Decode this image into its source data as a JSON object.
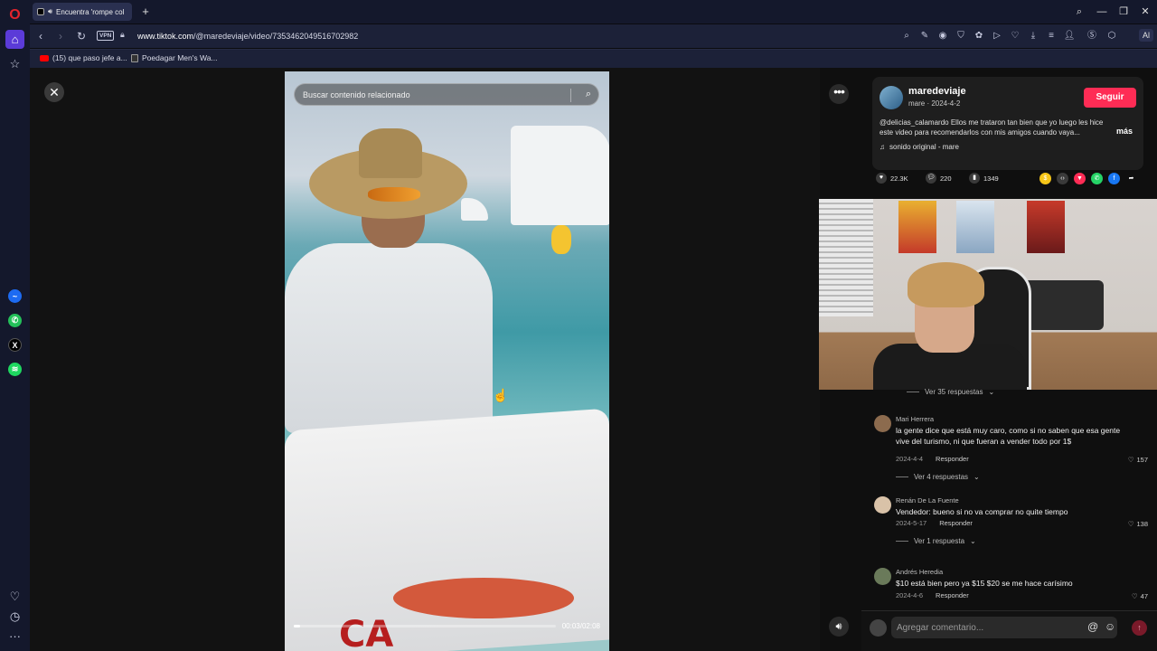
{
  "browser": {
    "tab_title": "Encuentra 'rompe col",
    "url_domain": "www.tiktok.com",
    "url_path": "/@maredeviaje/video/7353462049516702982",
    "vpn_label": "VPN",
    "ai_label": "Al",
    "bookmarks": [
      {
        "label": "(15) que paso jefe a..."
      },
      {
        "label": "Poedagar Men's Wa..."
      }
    ]
  },
  "video": {
    "search_placeholder": "Buscar contenido relacionado",
    "time": "00:03/02:08",
    "progress": 0.023,
    "brand_text": "CA"
  },
  "author": {
    "username": "maredeviaje",
    "subline": "mare · 2024-4-2",
    "follow_label": "Seguir",
    "description": "@delicias_calamardo Ellos me trataron tan bien que yo luego les hice este video para recomendarlos con mis amigos cuando vaya...",
    "more_label": "más",
    "sound": "sonido original - mare"
  },
  "stats": {
    "likes": "22.3K",
    "comments": "220",
    "saves": "1349"
  },
  "comments": {
    "top_replies_toggle": "Ver 35 respuestas",
    "items": [
      {
        "user": "Mari Herrera",
        "text": "la gente dice que está muy caro, como si no saben que esa gente vive del turismo, ni que fueran a vender todo por 1$",
        "date": "2024-4-4",
        "reply_label": "Responder",
        "likes": "157",
        "replies_toggle": "Ver 4 respuestas"
      },
      {
        "user": "Renán De La Fuente",
        "text": "Vendedor: bueno si no va comprar no quite tiempo",
        "date": "2024-5-17",
        "reply_label": "Responder",
        "likes": "138",
        "replies_toggle": "Ver 1 respuesta"
      },
      {
        "user": "Andrés Heredia",
        "text": "$10 está bien pero ya $15 $20 se me hace carísimo",
        "date": "2024-4-6",
        "reply_label": "Responder",
        "likes": "47"
      }
    ]
  },
  "comment_bar": {
    "placeholder": "Agregar comentario..."
  },
  "colors": {
    "accent": "#fe2c55",
    "opera_red": "#e2242d",
    "sidebar_active": "#5b3bd8"
  }
}
